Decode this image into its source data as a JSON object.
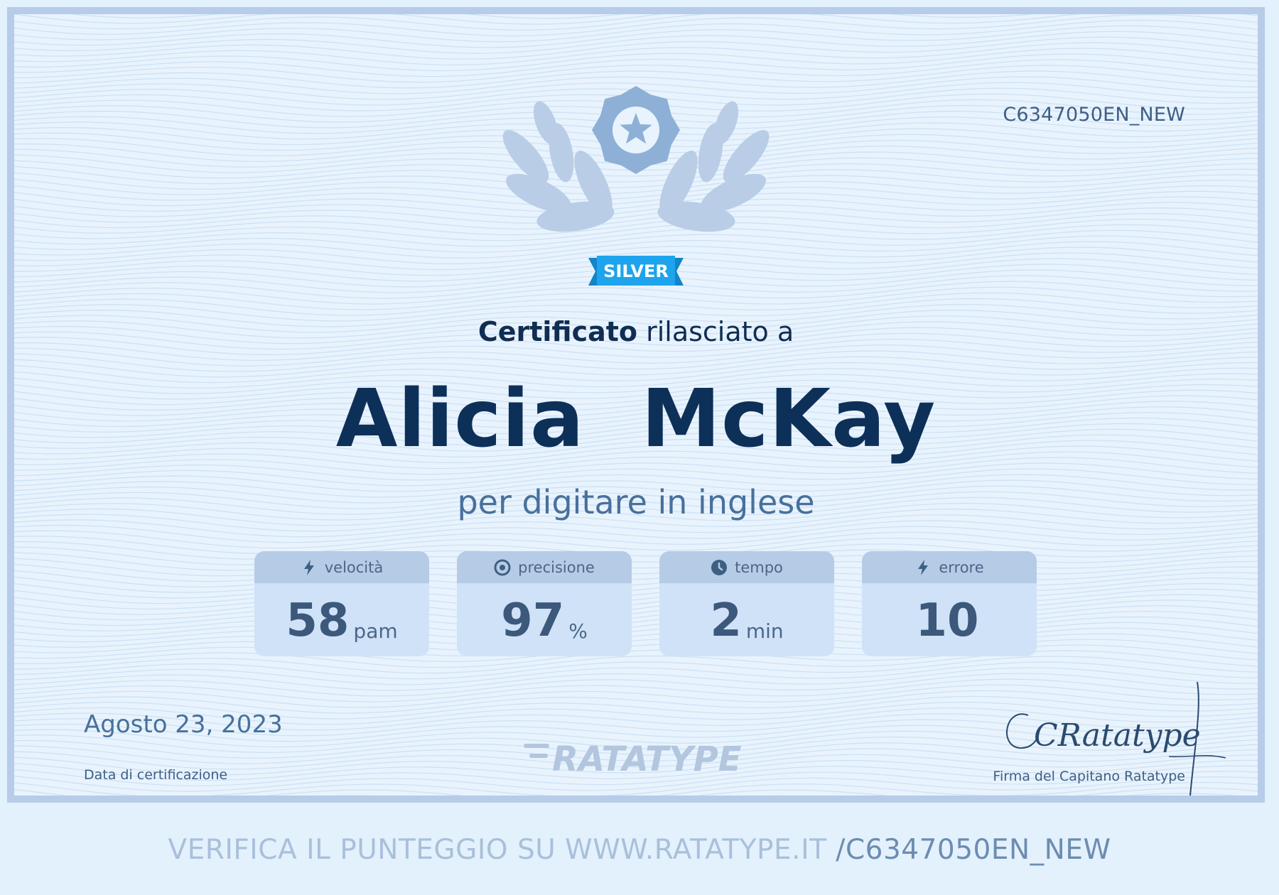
{
  "certificate": {
    "id": "C6347050EN_NEW",
    "level": "SILVER",
    "issued_bold": "Certificato",
    "issued_rest": " rilasciato a",
    "recipient": "Alicia  McKay",
    "subject": "per digitare in inglese",
    "date": "Agosto 23, 2023",
    "date_label": "Data di certificazione",
    "logo": "RATATYPE",
    "signature_text": "CRatatype",
    "signature_label": "Firma del Capitano Ratatype"
  },
  "stats": [
    {
      "icon": "lightning-icon",
      "label": "velocità",
      "value": "58",
      "unit": "pam"
    },
    {
      "icon": "target-icon",
      "label": "precisione",
      "value": "97",
      "unit": "%"
    },
    {
      "icon": "clock-icon",
      "label": "tempo",
      "value": "2",
      "unit": "min"
    },
    {
      "icon": "lightning-icon",
      "label": "errore",
      "value": "10",
      "unit": ""
    }
  ],
  "footer": {
    "verify_text": "VERIFICA IL PUNTEGGIO SU WWW.RATATYPE.IT",
    "verify_path": " /C6347050EN_NEW"
  },
  "colors": {
    "page_bg": "#e3f1fd",
    "border": "#b6cce8",
    "name": "#0d3059",
    "ribbon": "#1ea4ec",
    "laurel": "#b9cde6",
    "medal": "#8eb0d6"
  }
}
